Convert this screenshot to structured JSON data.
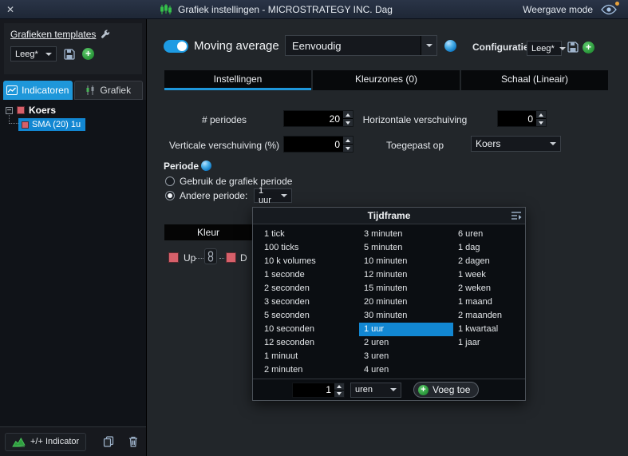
{
  "colors": {
    "accent": "#1e97da",
    "selection": "#1287d2",
    "green": "#2f9e3f",
    "swatch_red": "#d7606a"
  },
  "titlebar": {
    "close": "✕",
    "title": "Grafiek instellingen - MICROSTRATEGY INC. Dag",
    "view_mode": "Weergave mode"
  },
  "sidebar": {
    "templates_label": "Grafieken templates",
    "template_value": "Leeg*",
    "tab_indicatoren": "Indicatoren",
    "tab_grafiek": "Grafiek",
    "tree_root": "Koers",
    "tree_child": "SMA (20) 1u",
    "add_indicator": "+/+ Indicator"
  },
  "main": {
    "indicator_name": "Moving average",
    "type_value": "Eenvoudig",
    "config_label": "Configuratie:",
    "config_value": "Leeg*",
    "tabs": {
      "settings": "Instellingen",
      "colorzones": "Kleurzones (0)",
      "scale": "Schaal (Lineair)"
    },
    "periods_label": "# periodes",
    "periods_value": "20",
    "hshift_label": "Horizontale verschuiving",
    "hshift_value": "0",
    "vshift_label": "Verticale verschuiving (%)",
    "vshift_value": "0",
    "applied_label": "Toegepast op",
    "applied_value": "Koers",
    "periode_label": "Periode",
    "radio_chart_period": "Gebruik de grafiek periode",
    "radio_other_period": "Andere periode:",
    "other_period_value": "1 uur",
    "kleur_header": "Kleur",
    "up_label": "Up",
    "down_label": "D"
  },
  "popup": {
    "title": "Tijdframe",
    "columns": [
      [
        "1 tick",
        "100 ticks",
        "10 k volumes",
        "1 seconde",
        "2 seconden",
        "3 seconden",
        "5 seconden",
        "10 seconden",
        "12 seconden",
        "1 minuut",
        "2 minuten"
      ],
      [
        "3 minuten",
        "5 minuten",
        "10 minuten",
        "12 minuten",
        "15 minuten",
        "20 minuten",
        "30 minuten",
        "1 uur",
        "2 uren",
        "3 uren",
        "4 uren"
      ],
      [
        "6 uren",
        "1 dag",
        "2 dagen",
        "1 week",
        "2 weken",
        "1 maand",
        "2 maanden",
        "1 kwartaal",
        "1 jaar"
      ]
    ],
    "selected": "1 uur",
    "count_value": "1",
    "unit_value": "uren",
    "add_label": "Voeg toe"
  }
}
